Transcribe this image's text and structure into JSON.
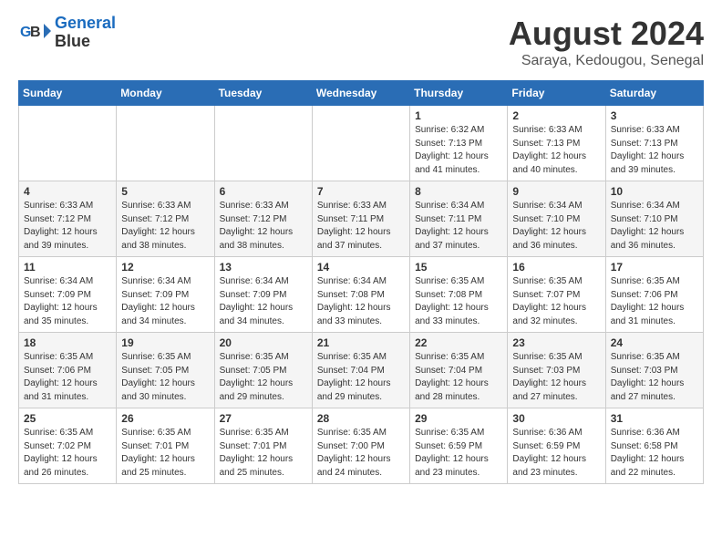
{
  "header": {
    "logo_line1": "General",
    "logo_line2": "Blue",
    "month_title": "August 2024",
    "subtitle": "Saraya, Kedougou, Senegal"
  },
  "days_of_week": [
    "Sunday",
    "Monday",
    "Tuesday",
    "Wednesday",
    "Thursday",
    "Friday",
    "Saturday"
  ],
  "weeks": [
    [
      {
        "day": "",
        "info": ""
      },
      {
        "day": "",
        "info": ""
      },
      {
        "day": "",
        "info": ""
      },
      {
        "day": "",
        "info": ""
      },
      {
        "day": "1",
        "info": "Sunrise: 6:32 AM\nSunset: 7:13 PM\nDaylight: 12 hours\nand 41 minutes."
      },
      {
        "day": "2",
        "info": "Sunrise: 6:33 AM\nSunset: 7:13 PM\nDaylight: 12 hours\nand 40 minutes."
      },
      {
        "day": "3",
        "info": "Sunrise: 6:33 AM\nSunset: 7:13 PM\nDaylight: 12 hours\nand 39 minutes."
      }
    ],
    [
      {
        "day": "4",
        "info": "Sunrise: 6:33 AM\nSunset: 7:12 PM\nDaylight: 12 hours\nand 39 minutes."
      },
      {
        "day": "5",
        "info": "Sunrise: 6:33 AM\nSunset: 7:12 PM\nDaylight: 12 hours\nand 38 minutes."
      },
      {
        "day": "6",
        "info": "Sunrise: 6:33 AM\nSunset: 7:12 PM\nDaylight: 12 hours\nand 38 minutes."
      },
      {
        "day": "7",
        "info": "Sunrise: 6:33 AM\nSunset: 7:11 PM\nDaylight: 12 hours\nand 37 minutes."
      },
      {
        "day": "8",
        "info": "Sunrise: 6:34 AM\nSunset: 7:11 PM\nDaylight: 12 hours\nand 37 minutes."
      },
      {
        "day": "9",
        "info": "Sunrise: 6:34 AM\nSunset: 7:10 PM\nDaylight: 12 hours\nand 36 minutes."
      },
      {
        "day": "10",
        "info": "Sunrise: 6:34 AM\nSunset: 7:10 PM\nDaylight: 12 hours\nand 36 minutes."
      }
    ],
    [
      {
        "day": "11",
        "info": "Sunrise: 6:34 AM\nSunset: 7:09 PM\nDaylight: 12 hours\nand 35 minutes."
      },
      {
        "day": "12",
        "info": "Sunrise: 6:34 AM\nSunset: 7:09 PM\nDaylight: 12 hours\nand 34 minutes."
      },
      {
        "day": "13",
        "info": "Sunrise: 6:34 AM\nSunset: 7:09 PM\nDaylight: 12 hours\nand 34 minutes."
      },
      {
        "day": "14",
        "info": "Sunrise: 6:34 AM\nSunset: 7:08 PM\nDaylight: 12 hours\nand 33 minutes."
      },
      {
        "day": "15",
        "info": "Sunrise: 6:35 AM\nSunset: 7:08 PM\nDaylight: 12 hours\nand 33 minutes."
      },
      {
        "day": "16",
        "info": "Sunrise: 6:35 AM\nSunset: 7:07 PM\nDaylight: 12 hours\nand 32 minutes."
      },
      {
        "day": "17",
        "info": "Sunrise: 6:35 AM\nSunset: 7:06 PM\nDaylight: 12 hours\nand 31 minutes."
      }
    ],
    [
      {
        "day": "18",
        "info": "Sunrise: 6:35 AM\nSunset: 7:06 PM\nDaylight: 12 hours\nand 31 minutes."
      },
      {
        "day": "19",
        "info": "Sunrise: 6:35 AM\nSunset: 7:05 PM\nDaylight: 12 hours\nand 30 minutes."
      },
      {
        "day": "20",
        "info": "Sunrise: 6:35 AM\nSunset: 7:05 PM\nDaylight: 12 hours\nand 29 minutes."
      },
      {
        "day": "21",
        "info": "Sunrise: 6:35 AM\nSunset: 7:04 PM\nDaylight: 12 hours\nand 29 minutes."
      },
      {
        "day": "22",
        "info": "Sunrise: 6:35 AM\nSunset: 7:04 PM\nDaylight: 12 hours\nand 28 minutes."
      },
      {
        "day": "23",
        "info": "Sunrise: 6:35 AM\nSunset: 7:03 PM\nDaylight: 12 hours\nand 27 minutes."
      },
      {
        "day": "24",
        "info": "Sunrise: 6:35 AM\nSunset: 7:03 PM\nDaylight: 12 hours\nand 27 minutes."
      }
    ],
    [
      {
        "day": "25",
        "info": "Sunrise: 6:35 AM\nSunset: 7:02 PM\nDaylight: 12 hours\nand 26 minutes."
      },
      {
        "day": "26",
        "info": "Sunrise: 6:35 AM\nSunset: 7:01 PM\nDaylight: 12 hours\nand 25 minutes."
      },
      {
        "day": "27",
        "info": "Sunrise: 6:35 AM\nSunset: 7:01 PM\nDaylight: 12 hours\nand 25 minutes."
      },
      {
        "day": "28",
        "info": "Sunrise: 6:35 AM\nSunset: 7:00 PM\nDaylight: 12 hours\nand 24 minutes."
      },
      {
        "day": "29",
        "info": "Sunrise: 6:35 AM\nSunset: 6:59 PM\nDaylight: 12 hours\nand 23 minutes."
      },
      {
        "day": "30",
        "info": "Sunrise: 6:36 AM\nSunset: 6:59 PM\nDaylight: 12 hours\nand 23 minutes."
      },
      {
        "day": "31",
        "info": "Sunrise: 6:36 AM\nSunset: 6:58 PM\nDaylight: 12 hours\nand 22 minutes."
      }
    ]
  ]
}
